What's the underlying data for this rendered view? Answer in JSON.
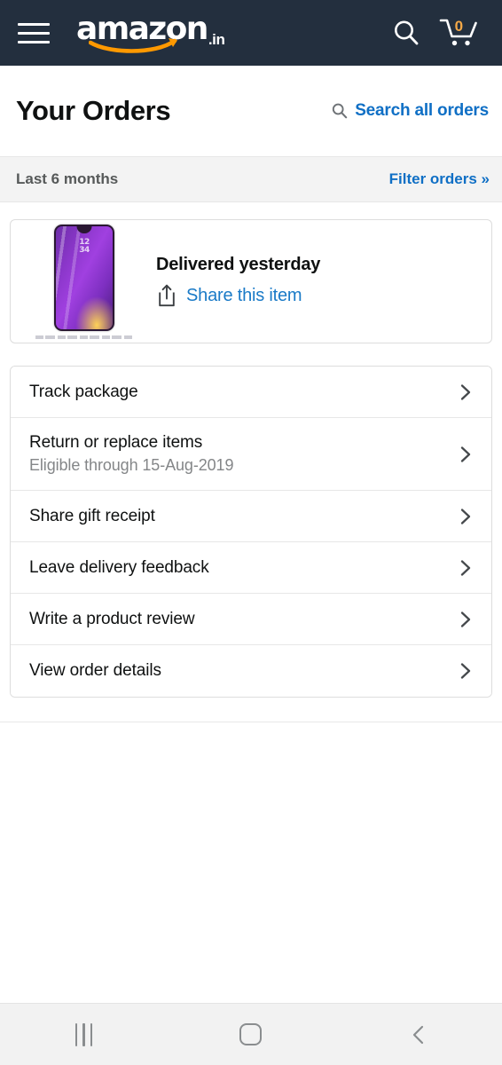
{
  "colors": {
    "header_bg": "#232F3E",
    "link_blue": "#0F6FC5",
    "share_blue": "#1A7AC7",
    "accent_orange": "#F3A847",
    "text_primary": "#0F1111",
    "text_muted": "#565959",
    "strip_bg": "#F3F3F3",
    "card_border": "#DDDDDD",
    "sysnav_bg": "#F2F2F2"
  },
  "topnav": {
    "menu_icon": "hamburger-menu-icon",
    "brand_word": "amazon",
    "brand_tld": ".in",
    "search_icon": "search-icon",
    "cart_icon": "shopping-cart-icon",
    "cart_count": "0"
  },
  "page_header": {
    "title": "Your Orders",
    "search_icon": "search-icon",
    "search_label": "Search all orders"
  },
  "filter_strip": {
    "period": "Last 6 months",
    "filter_label": "Filter orders »"
  },
  "order_card": {
    "product_image": "smartphone-purple-gradient-thumbnail",
    "status": "Delivered yesterday",
    "share_icon": "share-icon",
    "share_label": "Share this item"
  },
  "actions": [
    {
      "label": "Track package",
      "sub": null,
      "icon": "chevron-right-icon"
    },
    {
      "label": "Return or replace items",
      "sub": "Eligible through 15-Aug-2019",
      "icon": "chevron-right-icon"
    },
    {
      "label": "Share gift receipt",
      "sub": null,
      "icon": "chevron-right-icon"
    },
    {
      "label": "Leave delivery feedback",
      "sub": null,
      "icon": "chevron-right-icon"
    },
    {
      "label": "Write a product review",
      "sub": null,
      "icon": "chevron-right-icon"
    },
    {
      "label": "View order details",
      "sub": null,
      "icon": "chevron-right-icon"
    }
  ],
  "system_nav": {
    "recents_icon": "recent-apps-icon",
    "home_icon": "home-icon",
    "back_icon": "back-chevron-icon"
  }
}
